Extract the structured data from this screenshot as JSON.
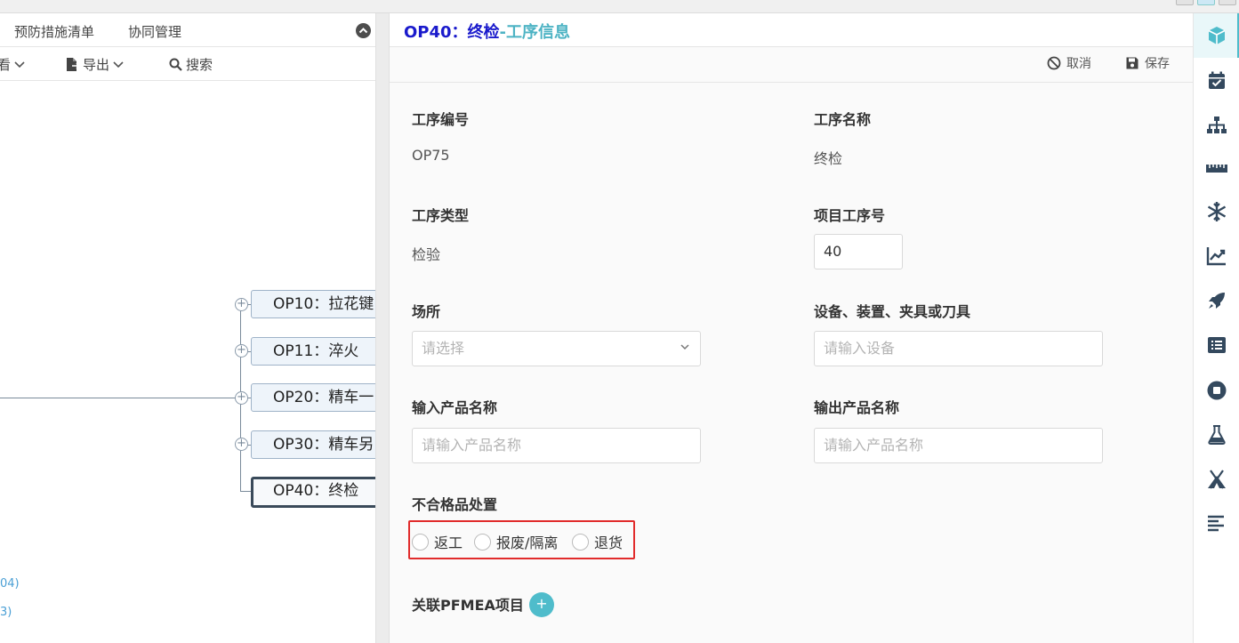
{
  "left": {
    "tabs": [
      "预防措施清单",
      "协同管理"
    ],
    "toolbar": {
      "view_label": "看",
      "export_label": "导出",
      "search_label": "搜索"
    },
    "nodes": [
      "OP10：拉花键",
      "OP11：淬火",
      "OP20：精车一",
      "OP30：精车另",
      "OP40：终检"
    ],
    "notes": [
      "04)",
      "3)"
    ]
  },
  "header": {
    "title_code": "OP40：终检",
    "title_suffix": "-工序信息"
  },
  "actions": {
    "cancel": "取消",
    "save": "保存"
  },
  "form": {
    "op_no_label": "工序编号",
    "op_no_value": "OP75",
    "op_name_label": "工序名称",
    "op_name_value": "终检",
    "op_type_label": "工序类型",
    "op_type_value": "检验",
    "proj_no_label": "项目工序号",
    "proj_no_value": "40",
    "site_label": "场所",
    "site_placeholder": "请选择",
    "equip_label": "设备、装置、夹具或刀具",
    "equip_placeholder": "请输入设备",
    "in_label": "输入产品名称",
    "in_placeholder": "请输入产品名称",
    "out_label": "输出产品名称",
    "out_placeholder": "请输入产品名称",
    "ncp_label": "不合格品处置",
    "ncp_options": [
      "返工",
      "报废/隔离",
      "退货"
    ],
    "pfmea_label": "关联PFMEA项目",
    "add_symbol": "+"
  },
  "sidebar_icons": [
    "cube-icon",
    "calendar-check-icon",
    "sitemap-icon",
    "ruler-icon",
    "snowflake-icon",
    "chart-line-icon",
    "rocket-icon",
    "list-icon",
    "stop-circle-icon",
    "flask-icon",
    "campground-icon",
    "align-left-icon"
  ],
  "colors": {
    "accent": "#4fbccb",
    "title_blue": "#1a1acc",
    "highlight_red": "#e12b2b"
  }
}
